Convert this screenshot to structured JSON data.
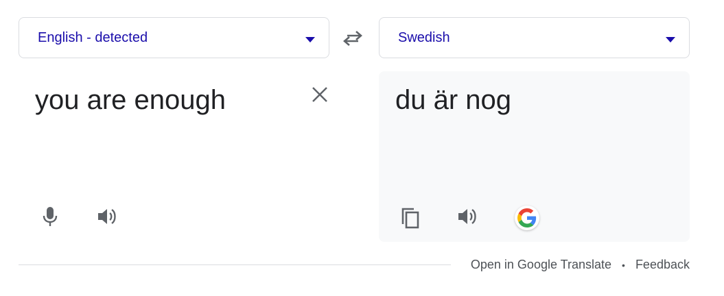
{
  "source": {
    "language": "English - detected",
    "text": "you are enough"
  },
  "target": {
    "language": "Swedish",
    "text": "du är nog"
  },
  "footer": {
    "open_link": "Open in Google Translate",
    "separator": "•",
    "feedback_link": "Feedback"
  },
  "colors": {
    "accent": "#1a0dab",
    "icon": "#5f6368",
    "panel": "#f8f9fa"
  },
  "icons": {
    "swap": "swap-arrows-icon",
    "clear": "close-icon",
    "mic": "microphone-icon",
    "listen": "speaker-icon",
    "copy": "copy-icon",
    "logo": "google-g-logo"
  }
}
